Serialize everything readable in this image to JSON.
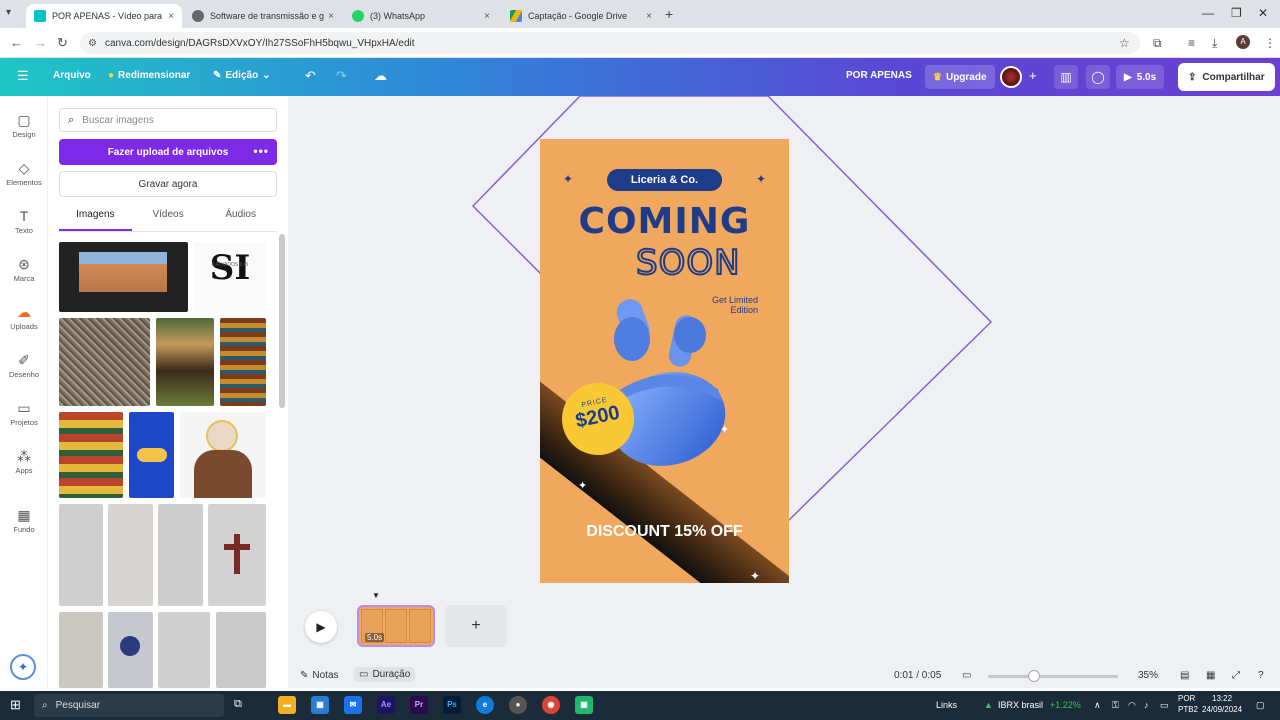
{
  "browser": {
    "tabs": [
      {
        "title": "POR APENAS - Vídeo para disp",
        "active": true,
        "favicon_color": "#00c4cc"
      },
      {
        "title": "Software de transmissão e gra",
        "active": false,
        "favicon_color": "#555555"
      },
      {
        "title": "(3) WhatsApp",
        "active": false,
        "favicon_color": "#25d366"
      },
      {
        "title": "Captação - Google Drive",
        "active": false,
        "favicon_color": "#f4b400"
      }
    ],
    "close_glyph": "×",
    "new_tab_glyph": "+",
    "url": "canva.com/design/DAGRsDXVxOY/Ih27SSoFhH5bqwu_VHpxHA/edit",
    "user_initial": "A"
  },
  "header": {
    "menu_icon": "hamburger-icon",
    "arquivo": "Arquivo",
    "redimensionar": "Redimensionar",
    "edicao": "Edição",
    "design_title": "POR APENAS",
    "upgrade": "Upgrade",
    "play_duration": "5.0s",
    "share": "Compartilhar"
  },
  "rail": [
    {
      "label": "Design",
      "icon": "design-icon"
    },
    {
      "label": "Elementos",
      "icon": "elements-icon"
    },
    {
      "label": "Texto",
      "icon": "text-icon"
    },
    {
      "label": "Marca",
      "icon": "brand-icon"
    },
    {
      "label": "Uploads",
      "icon": "cloud-upload-icon",
      "active": true
    },
    {
      "label": "Desenho",
      "icon": "draw-icon"
    },
    {
      "label": "Projetos",
      "icon": "folder-icon"
    },
    {
      "label": "Apps",
      "icon": "apps-icon"
    },
    {
      "label": "Fundo",
      "icon": "background-icon"
    }
  ],
  "panel": {
    "search_placeholder": "Buscar imagens",
    "upload_button": "Fazer upload de arquivos",
    "record_button": "Gravar agora",
    "tabs": [
      "Imagens",
      "Vídeos",
      "Áudios"
    ],
    "active_tab": "Imagens",
    "logo_thumb_text": "SI",
    "logo_thumb_sub": "SALVADOS IUB"
  },
  "poster": {
    "brand": "Liceria & Co.",
    "headline1": "COMING",
    "headline2": "SOON",
    "tagline_line1": "Get Limited",
    "tagline_line2": "Edition",
    "price_label": "PRICE",
    "price_value": "$200",
    "discount": "DISCOUNT 15% OFF"
  },
  "timeline": {
    "clip_duration": "5.0s"
  },
  "bottom": {
    "notes": "Notas",
    "duration": "Duração",
    "time": "0:01 / 0:05",
    "zoom": "35%"
  },
  "taskbar": {
    "search": "Pesquisar",
    "links": "Links",
    "ticker": "IBRX brasil",
    "ticker_change": "+1.22%",
    "lang1": "POR",
    "lang2": "PTB2",
    "time": "13:22",
    "date": "24/09/2024"
  },
  "colors": {
    "canva_purple": "#7d2ae8",
    "poster_orange": "#f0a75e",
    "poster_navy": "#1f3c8a",
    "price_yellow": "#f9c935"
  }
}
